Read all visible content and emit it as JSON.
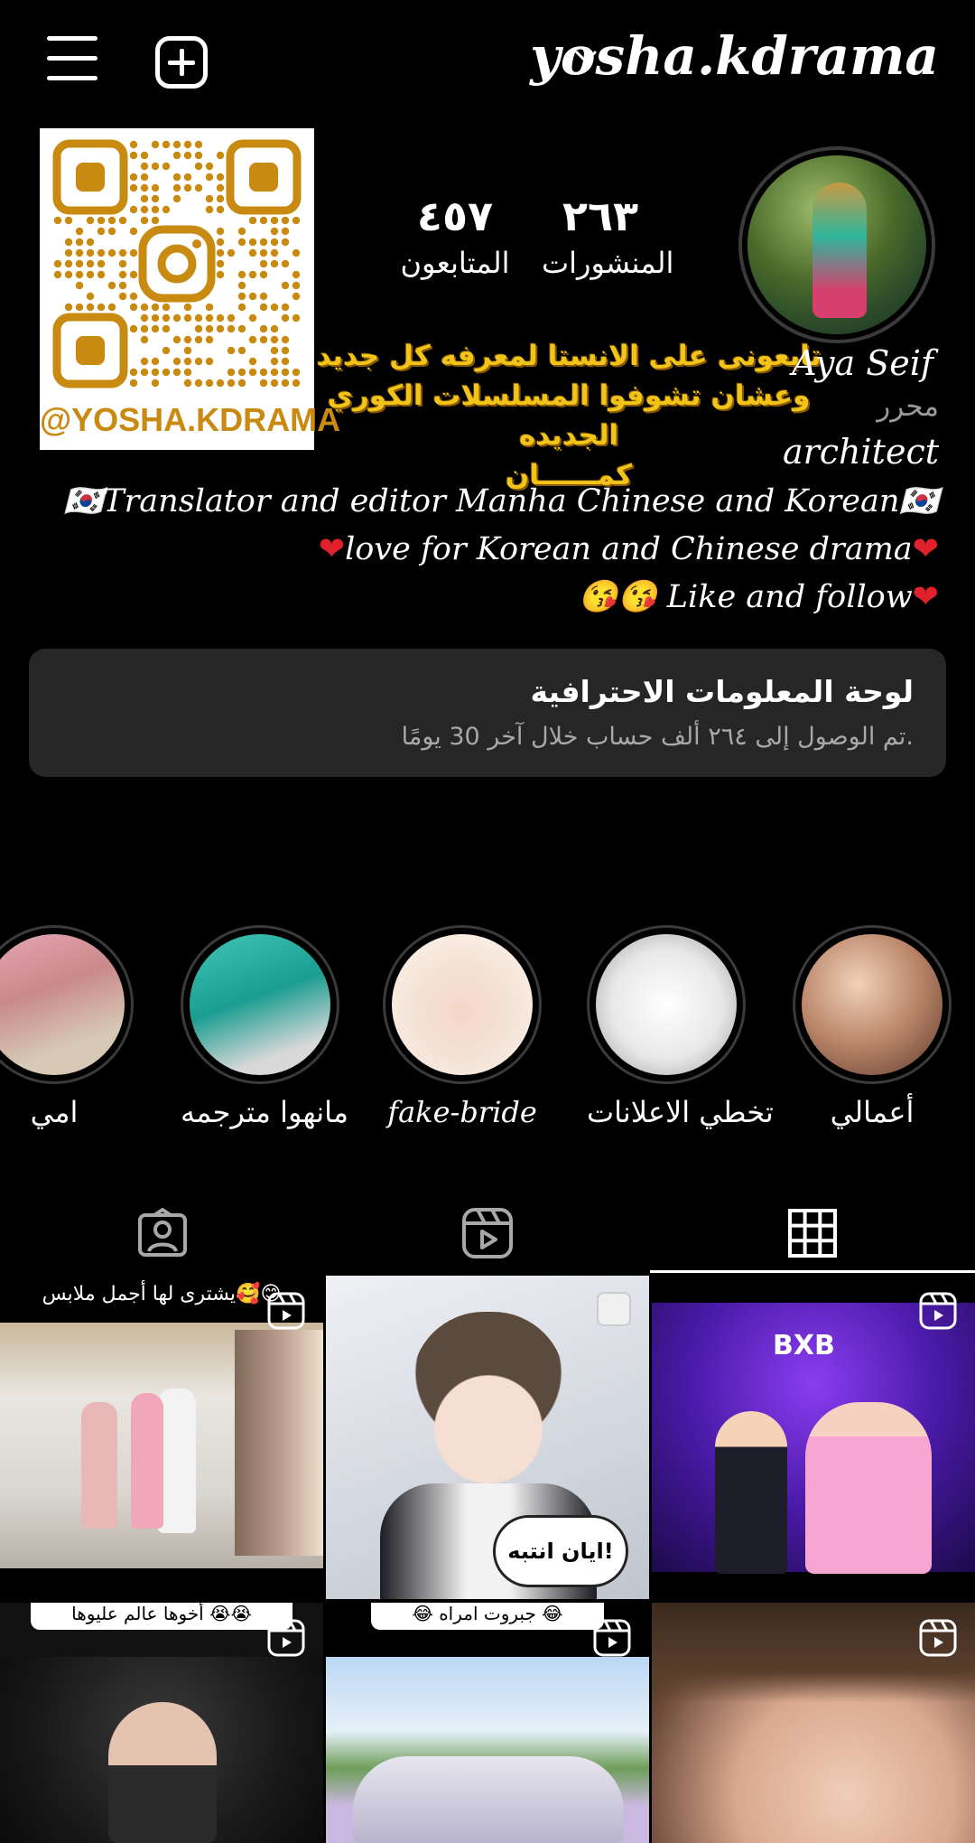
{
  "header": {
    "username": "yosha.kdrama",
    "menu_icon": "hamburger-menu-icon",
    "create_icon": "plus-square-icon",
    "dropdown_icon": "chevron-down-icon"
  },
  "qr": {
    "label": "@YOSHA.KDRAMA",
    "color": "#c98a12"
  },
  "profile": {
    "stats": {
      "posts_value": "٢٦٣",
      "posts_label": "المنشورات",
      "followers_value": "٤٥٧",
      "followers_label": "المتابعون"
    },
    "banner_lines": [
      "تابعونى على الانستا لمعرفه كل جديد",
      "وعشان تشوفوا المسلسلات الكوري الجديده",
      "كمــــــان"
    ],
    "name": "Aya Seif",
    "category": "محرر",
    "role": "architect",
    "bio": {
      "line1_text": "Translator and editor Manha Chinese and Korean",
      "line1_flag": "🇰🇷",
      "line2_text": "love for Korean and Chinese drama",
      "line2_heart": "❤",
      "line3_text": "Like and follow",
      "line3_emoji": "😘😘",
      "line3_heart": "❤"
    }
  },
  "dashboard": {
    "title": "لوحة المعلومات الاحترافية",
    "subtitle": "تم الوصول إلى ٢٦٤ ألف حساب خلال آخر 30 يومًا."
  },
  "highlights": [
    {
      "label": "أعمالي"
    },
    {
      "label": "تخطي الاعلانات"
    },
    {
      "label": "fake-bride"
    },
    {
      "label": "مانهوا مترجمه"
    },
    {
      "label": "امي"
    }
  ],
  "tabs": [
    {
      "name": "tagged",
      "icon": "person-tag-icon"
    },
    {
      "name": "reels",
      "icon": "reels-icon"
    },
    {
      "name": "grid",
      "icon": "grid-icon"
    }
  ],
  "grid": {
    "captions": {
      "post1": "يشترى لها أجمل ملابس🥰😊",
      "post4": "أخوها عالم عليوها 😭😭",
      "post5": "😂 جبروت امراه 😂"
    },
    "post2_text": "ايان انتبه!",
    "post3_text": "BXB"
  }
}
